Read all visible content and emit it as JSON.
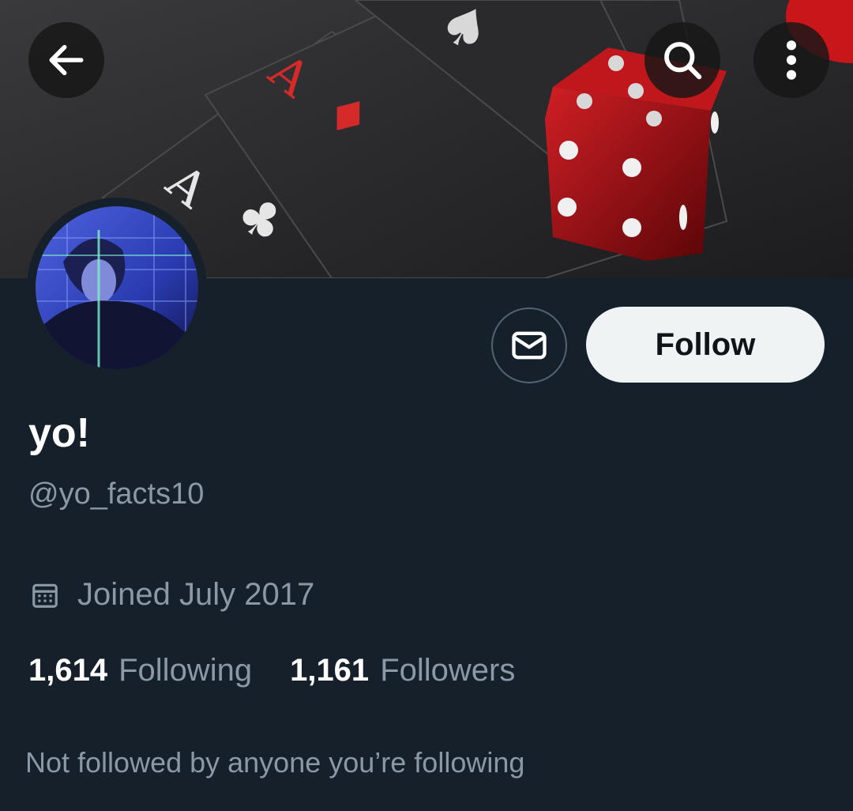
{
  "profile": {
    "display_name": "yo!",
    "handle": "@yo_facts10",
    "joined": "Joined July 2017",
    "following_count": "1,614",
    "following_label": "Following",
    "followers_count": "1,161",
    "followers_label": "Followers",
    "mutuals_note": "Not followed by anyone you’re following"
  },
  "actions": {
    "follow_label": "Follow",
    "message_icon": "mail-icon"
  },
  "header": {
    "back_icon": "arrow-left-icon",
    "search_icon": "search-icon",
    "more_icon": "more-vertical-icon"
  },
  "colors": {
    "background": "#15202b",
    "secondary_text": "#8b98a5",
    "follow_button_bg": "#eff3f4",
    "follow_button_text": "#0f1419"
  }
}
